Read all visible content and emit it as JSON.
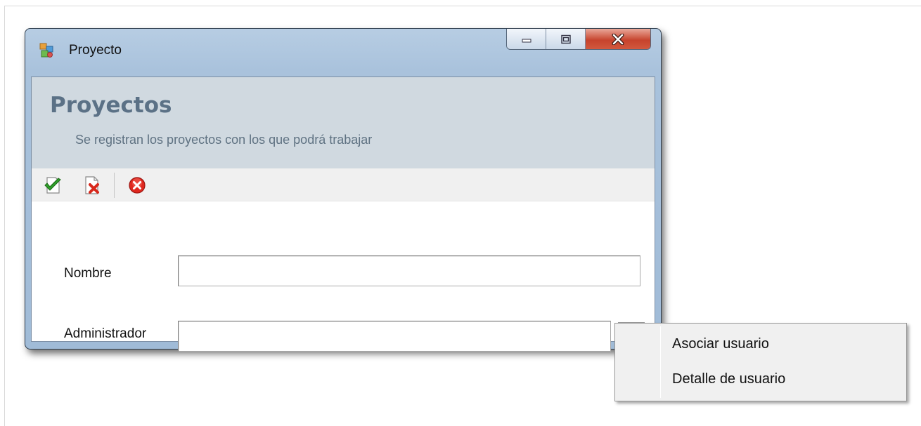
{
  "window": {
    "title": "Proyecto",
    "icons": {
      "app": "project-app-icon",
      "minimize": "minimize-icon",
      "maximize": "maximize-icon",
      "close": "close-x-icon"
    }
  },
  "header": {
    "title": "Proyectos",
    "subtitle": "Se registran los proyectos con los que podrá trabajar"
  },
  "toolbar": {
    "buttons": [
      {
        "icon": "save-check-icon"
      },
      {
        "icon": "delete-document-icon"
      },
      {
        "icon": "cancel-circle-icon"
      }
    ]
  },
  "form": {
    "nombre": {
      "label": "Nombre",
      "value": "",
      "placeholder": ""
    },
    "administrador": {
      "label": "Administrador",
      "value": "",
      "placeholder": ""
    }
  },
  "context_menu": {
    "items": [
      {
        "label": "Asociar usuario"
      },
      {
        "label": "Detalle de usuario"
      }
    ]
  },
  "colors": {
    "header_bg": "#d0d9e0",
    "header_title": "#5b7186",
    "frame": "#a9c2dc",
    "close_button": "#c7432c"
  }
}
